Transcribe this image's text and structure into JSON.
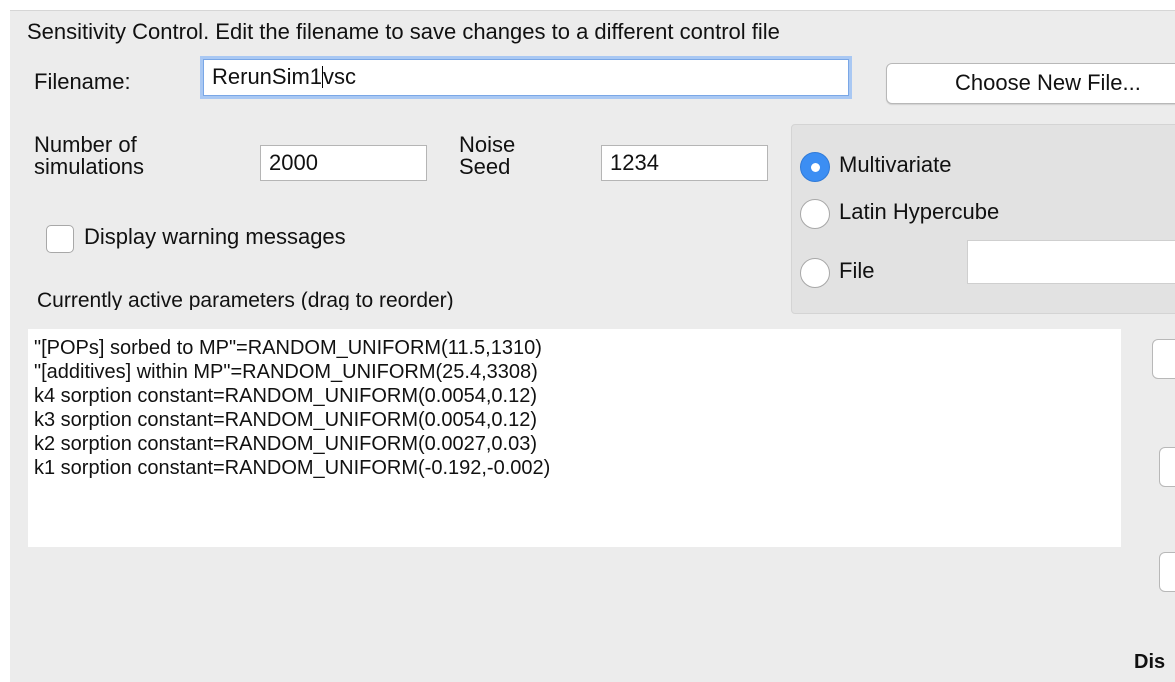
{
  "header": {
    "title": "Sensitivity Control.  Edit the filename to save changes to a different control file"
  },
  "file": {
    "label": "Filename:",
    "value_before_caret": "RerunSim1",
    "value_after_caret": "vsc",
    "choose_button": "Choose New File..."
  },
  "simulations": {
    "label_line1": "Number of",
    "label_line2": "simulations",
    "value": "2000"
  },
  "noise_seed": {
    "label_line1": "Noise",
    "label_line2": "Seed",
    "value": "1234"
  },
  "method": {
    "options": [
      {
        "label": "Multivariate",
        "selected": true
      },
      {
        "label": "Latin Hypercube",
        "selected": false
      },
      {
        "label": "File",
        "selected": false
      }
    ],
    "file_value": ""
  },
  "warnings": {
    "label": "Display warning messages",
    "checked": false
  },
  "parameters": {
    "heading": "Currently active parameters (drag to reorder)",
    "items": [
      "\"[POPs] sorbed to MP\"=RANDOM_UNIFORM(11.5,1310)",
      "\"[additives] within MP\"=RANDOM_UNIFORM(25.4,3308)",
      "k4 sorption constant=RANDOM_UNIFORM(0.0054,0.12)",
      "k3 sorption constant=RANDOM_UNIFORM(0.0054,0.12)",
      "k2 sorption constant=RANDOM_UNIFORM(0.0027,0.03)",
      "k1 sorption constant=RANDOM_UNIFORM(-0.192,-0.002)"
    ]
  },
  "footer": {
    "partial_label": "Dis"
  },
  "colors": {
    "panel_bg": "#ececec",
    "radio_selected": "#3c8ef3",
    "focus_ring": "#a9c8f3"
  }
}
